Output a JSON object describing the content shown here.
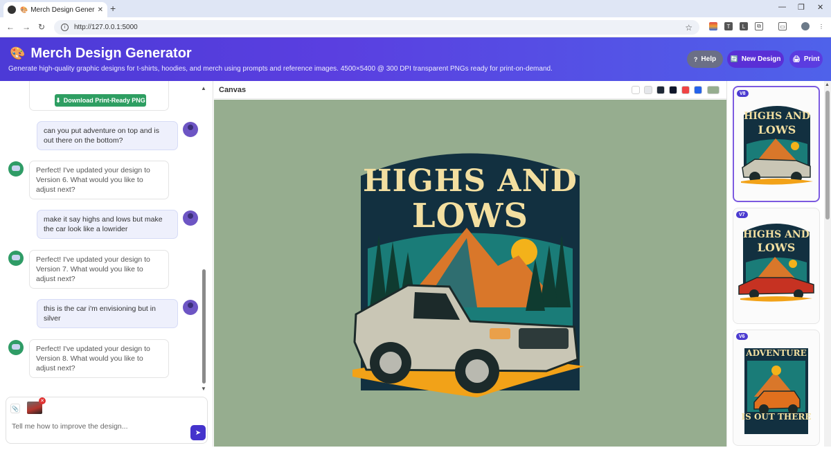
{
  "browser": {
    "tab_title": "Merch Design Generator - ",
    "url": "http://127.0.0.1:5000"
  },
  "header": {
    "title": "Merch Design Generator",
    "subtitle": "Generate high-quality graphic designs for t-shirts, hoodies, and merch using prompts and reference images. 4500×5400 @ 300 DPI transparent PNGs ready for print-on-demand.",
    "help_label": "Help",
    "new_design_label": "New Design",
    "print_label": "Print"
  },
  "chat": {
    "download_label": "Download Print-Ready PNG",
    "messages": [
      {
        "role": "user",
        "text": "can you put adventure on top and is out there on the bottom?"
      },
      {
        "role": "bot",
        "text": "Perfect! I've updated your design to Version 6. What would you like to adjust next?"
      },
      {
        "role": "user",
        "text": "make it say highs and lows but make the car look like a lowrider"
      },
      {
        "role": "bot",
        "text": "Perfect! I've updated your design to Version 7. What would you like to adjust next?"
      },
      {
        "role": "user",
        "text": "this is the car i'm envisioning but in silver"
      },
      {
        "role": "bot",
        "text": "Perfect! I've updated your design to Version 8. What would you like to adjust next?"
      }
    ],
    "input_placeholder": "Tell me how to improve the design..."
  },
  "canvas": {
    "label": "Canvas",
    "background_swatches": [
      "#ffffff",
      "#e5e7eb",
      "#1f2937",
      "#0f172a",
      "#ef4444",
      "#2563eb",
      "#96ad8f"
    ],
    "design_text_top": "HIGHS AND",
    "design_text_bottom": "LOWS"
  },
  "versions": [
    {
      "badge": "V8",
      "line1": "HIGHS AND",
      "line2": "LOWS"
    },
    {
      "badge": "V7",
      "line1": "HIGHS AND",
      "line2": "LOWS"
    },
    {
      "badge": "V6",
      "line1": "ADVENTURE",
      "line2": "IS OUT THERE"
    }
  ]
}
